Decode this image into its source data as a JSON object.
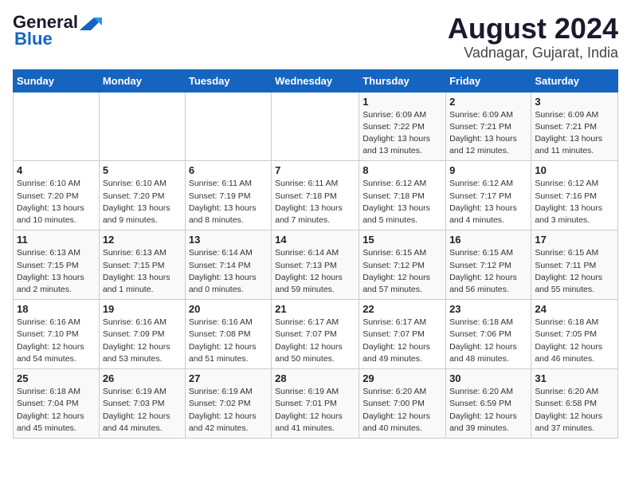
{
  "header": {
    "logo_line1": "General",
    "logo_line2": "Blue",
    "title": "August 2024",
    "subtitle": "Vadnagar, Gujarat, India"
  },
  "days_of_week": [
    "Sunday",
    "Monday",
    "Tuesday",
    "Wednesday",
    "Thursday",
    "Friday",
    "Saturday"
  ],
  "weeks": [
    [
      {
        "day": "",
        "info": ""
      },
      {
        "day": "",
        "info": ""
      },
      {
        "day": "",
        "info": ""
      },
      {
        "day": "",
        "info": ""
      },
      {
        "day": "1",
        "info": "Sunrise: 6:09 AM\nSunset: 7:22 PM\nDaylight: 13 hours\nand 13 minutes."
      },
      {
        "day": "2",
        "info": "Sunrise: 6:09 AM\nSunset: 7:21 PM\nDaylight: 13 hours\nand 12 minutes."
      },
      {
        "day": "3",
        "info": "Sunrise: 6:09 AM\nSunset: 7:21 PM\nDaylight: 13 hours\nand 11 minutes."
      }
    ],
    [
      {
        "day": "4",
        "info": "Sunrise: 6:10 AM\nSunset: 7:20 PM\nDaylight: 13 hours\nand 10 minutes."
      },
      {
        "day": "5",
        "info": "Sunrise: 6:10 AM\nSunset: 7:20 PM\nDaylight: 13 hours\nand 9 minutes."
      },
      {
        "day": "6",
        "info": "Sunrise: 6:11 AM\nSunset: 7:19 PM\nDaylight: 13 hours\nand 8 minutes."
      },
      {
        "day": "7",
        "info": "Sunrise: 6:11 AM\nSunset: 7:18 PM\nDaylight: 13 hours\nand 7 minutes."
      },
      {
        "day": "8",
        "info": "Sunrise: 6:12 AM\nSunset: 7:18 PM\nDaylight: 13 hours\nand 5 minutes."
      },
      {
        "day": "9",
        "info": "Sunrise: 6:12 AM\nSunset: 7:17 PM\nDaylight: 13 hours\nand 4 minutes."
      },
      {
        "day": "10",
        "info": "Sunrise: 6:12 AM\nSunset: 7:16 PM\nDaylight: 13 hours\nand 3 minutes."
      }
    ],
    [
      {
        "day": "11",
        "info": "Sunrise: 6:13 AM\nSunset: 7:15 PM\nDaylight: 13 hours\nand 2 minutes."
      },
      {
        "day": "12",
        "info": "Sunrise: 6:13 AM\nSunset: 7:15 PM\nDaylight: 13 hours\nand 1 minute."
      },
      {
        "day": "13",
        "info": "Sunrise: 6:14 AM\nSunset: 7:14 PM\nDaylight: 13 hours\nand 0 minutes."
      },
      {
        "day": "14",
        "info": "Sunrise: 6:14 AM\nSunset: 7:13 PM\nDaylight: 12 hours\nand 59 minutes."
      },
      {
        "day": "15",
        "info": "Sunrise: 6:15 AM\nSunset: 7:12 PM\nDaylight: 12 hours\nand 57 minutes."
      },
      {
        "day": "16",
        "info": "Sunrise: 6:15 AM\nSunset: 7:12 PM\nDaylight: 12 hours\nand 56 minutes."
      },
      {
        "day": "17",
        "info": "Sunrise: 6:15 AM\nSunset: 7:11 PM\nDaylight: 12 hours\nand 55 minutes."
      }
    ],
    [
      {
        "day": "18",
        "info": "Sunrise: 6:16 AM\nSunset: 7:10 PM\nDaylight: 12 hours\nand 54 minutes."
      },
      {
        "day": "19",
        "info": "Sunrise: 6:16 AM\nSunset: 7:09 PM\nDaylight: 12 hours\nand 53 minutes."
      },
      {
        "day": "20",
        "info": "Sunrise: 6:16 AM\nSunset: 7:08 PM\nDaylight: 12 hours\nand 51 minutes."
      },
      {
        "day": "21",
        "info": "Sunrise: 6:17 AM\nSunset: 7:07 PM\nDaylight: 12 hours\nand 50 minutes."
      },
      {
        "day": "22",
        "info": "Sunrise: 6:17 AM\nSunset: 7:07 PM\nDaylight: 12 hours\nand 49 minutes."
      },
      {
        "day": "23",
        "info": "Sunrise: 6:18 AM\nSunset: 7:06 PM\nDaylight: 12 hours\nand 48 minutes."
      },
      {
        "day": "24",
        "info": "Sunrise: 6:18 AM\nSunset: 7:05 PM\nDaylight: 12 hours\nand 46 minutes."
      }
    ],
    [
      {
        "day": "25",
        "info": "Sunrise: 6:18 AM\nSunset: 7:04 PM\nDaylight: 12 hours\nand 45 minutes."
      },
      {
        "day": "26",
        "info": "Sunrise: 6:19 AM\nSunset: 7:03 PM\nDaylight: 12 hours\nand 44 minutes."
      },
      {
        "day": "27",
        "info": "Sunrise: 6:19 AM\nSunset: 7:02 PM\nDaylight: 12 hours\nand 42 minutes."
      },
      {
        "day": "28",
        "info": "Sunrise: 6:19 AM\nSunset: 7:01 PM\nDaylight: 12 hours\nand 41 minutes."
      },
      {
        "day": "29",
        "info": "Sunrise: 6:20 AM\nSunset: 7:00 PM\nDaylight: 12 hours\nand 40 minutes."
      },
      {
        "day": "30",
        "info": "Sunrise: 6:20 AM\nSunset: 6:59 PM\nDaylight: 12 hours\nand 39 minutes."
      },
      {
        "day": "31",
        "info": "Sunrise: 6:20 AM\nSunset: 6:58 PM\nDaylight: 12 hours\nand 37 minutes."
      }
    ]
  ]
}
